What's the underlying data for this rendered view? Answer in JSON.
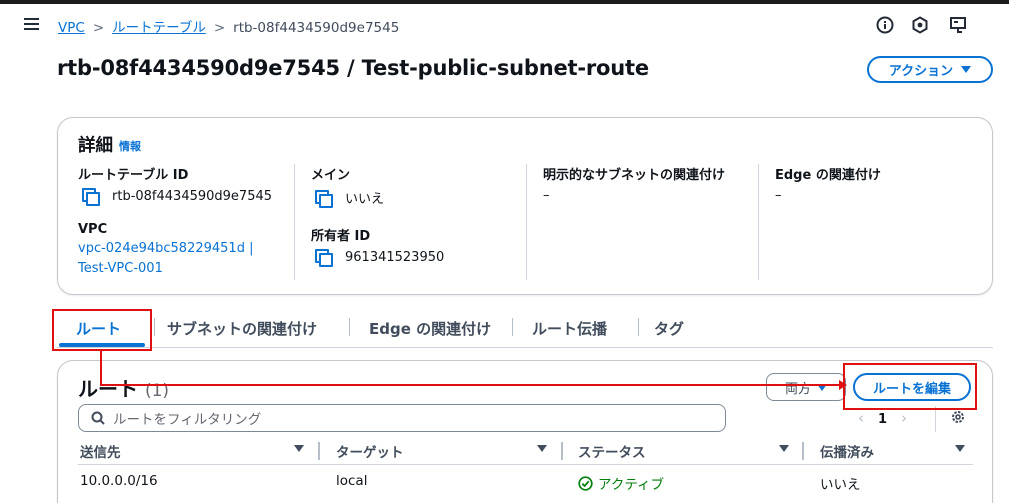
{
  "breadcrumb": {
    "items": [
      "VPC",
      "ルートテーブル"
    ],
    "current": "rtb-08f4434590d9e7545",
    "separator": ">"
  },
  "header": {
    "title": "rtb-08f4434590d9e7545 / Test-public-subnet-route",
    "action_label": "アクション"
  },
  "details": {
    "title": "詳細",
    "info_link": "情報",
    "route_table_id_label": "ルートテーブル ID",
    "route_table_id_value": "rtb-08f4434590d9e7545",
    "vpc_label": "VPC",
    "vpc_value_line1": "vpc-024e94bc58229451d |",
    "vpc_value_line2": "Test-VPC-001",
    "main_label": "メイン",
    "main_value": "いいえ",
    "owner_label": "所有者 ID",
    "owner_value": "961341523950",
    "explicit_subnet_label": "明示的なサブネットの関連付け",
    "explicit_subnet_value": "–",
    "edge_label": "Edge の関連付け",
    "edge_value": "–"
  },
  "tabs": [
    {
      "label": "ルート",
      "active": true
    },
    {
      "label": "サブネットの関連付け",
      "active": false
    },
    {
      "label": "Edge の関連付け",
      "active": false
    },
    {
      "label": "ルート伝播",
      "active": false
    },
    {
      "label": "タグ",
      "active": false
    }
  ],
  "routes": {
    "title": "ルート",
    "count": "(1)",
    "filter_select": "両方",
    "edit_button": "ルートを編集",
    "search_placeholder": "ルートをフィルタリング",
    "page_number": "1",
    "columns": [
      "送信先",
      "ターゲット",
      "ステータス",
      "伝播済み"
    ],
    "rows": [
      {
        "destination": "10.0.0.0/16",
        "target": "local",
        "status": "アクティブ",
        "propagated": "いいえ"
      }
    ]
  },
  "colors": {
    "link": "#0972d3",
    "success": "#037f0c",
    "annotation_red": "#e01010"
  }
}
